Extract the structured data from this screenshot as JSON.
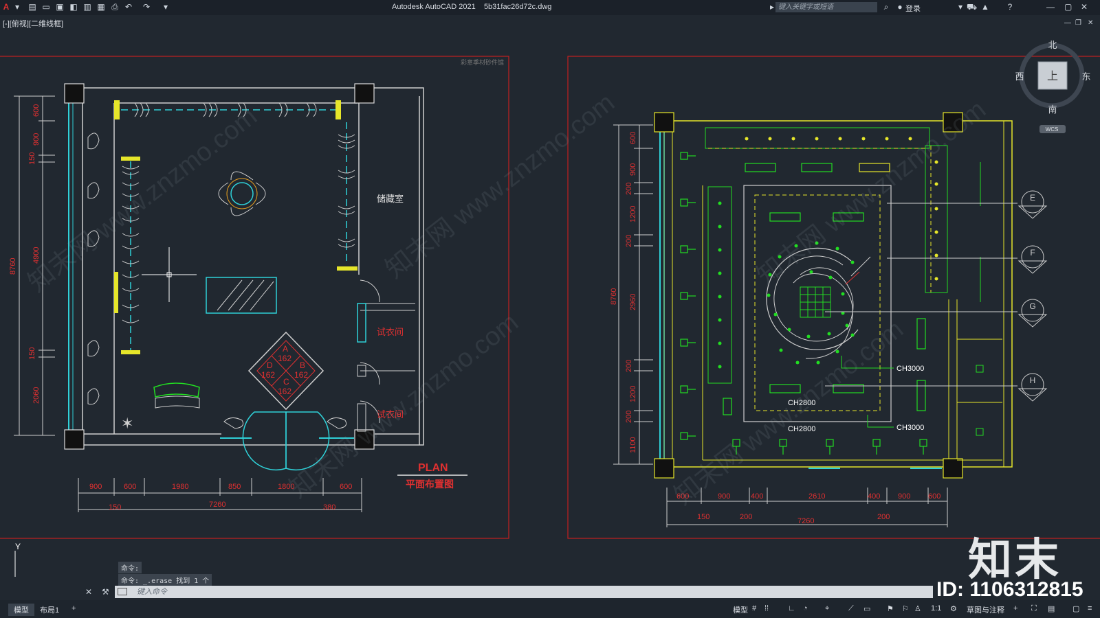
{
  "app": {
    "title": "Autodesk AutoCAD 2021",
    "filename": "5b31fac26d72c.dwg",
    "logo": "A",
    "search_placeholder": "键入关键字或短语",
    "login": "登录",
    "view_label": "[-][俯视][二维线框]"
  },
  "left_plan": {
    "storage_label": "储藏室",
    "fitting1_label": "试衣间",
    "fitting2_label": "试衣间",
    "plan_title": "PLAN",
    "plan_subtitle": "平面布置图",
    "corner_tag": "彩意季材砂件馆",
    "diamond": {
      "a": "A",
      "b": "B",
      "c": "C",
      "d": "D",
      "v1": "162",
      "v2": "162",
      "v3": "162",
      "v4": "162"
    },
    "dims_bottom_1": [
      "900",
      "600",
      "1980",
      "850",
      "1800",
      "600"
    ],
    "dims_bottom_2": [
      "150",
      "7260",
      "380"
    ],
    "dims_left": [
      "600",
      "900",
      "150",
      "4900",
      "150",
      "2060"
    ],
    "total_left": "8760"
  },
  "right_plan": {
    "ch_labels": [
      "CH3000",
      "CH2800",
      "CH2800",
      "CH3000"
    ],
    "section_markers": [
      "E",
      "F",
      "G",
      "H"
    ],
    "dims_bottom_1": [
      "600",
      "900",
      "400",
      "2610",
      "400",
      "900",
      "600"
    ],
    "dims_bottom_2": [
      "150",
      "200",
      "7260",
      "200"
    ],
    "dims_left": [
      "600",
      "900",
      "200",
      "1200",
      "200",
      "2960",
      "200",
      "1200",
      "200",
      "1100"
    ],
    "total_left": "8760"
  },
  "viewcube": {
    "north": "北",
    "south": "南",
    "west": "西",
    "east": "东",
    "face": "上",
    "wcs": "WCS"
  },
  "command": {
    "history": [
      "命令:",
      "命令: _.erase 找到 1 个"
    ],
    "placeholder": "键入命令"
  },
  "status": {
    "tabs": [
      "模型",
      "布局1",
      "+"
    ],
    "model": "模型",
    "scale": "1:1",
    "workspace": "草图与注释"
  },
  "branding": {
    "name": "知末",
    "id": "ID: 1106312815",
    "watermark": "知末网 www.znzmo.com"
  },
  "colors": {
    "background": "#212830",
    "frame": "#c42020",
    "wall": "#d8d8d8",
    "cyan": "#2fd1d8",
    "green": "#22dd22",
    "yellow": "#e6e62a",
    "red_text": "#e03030"
  }
}
